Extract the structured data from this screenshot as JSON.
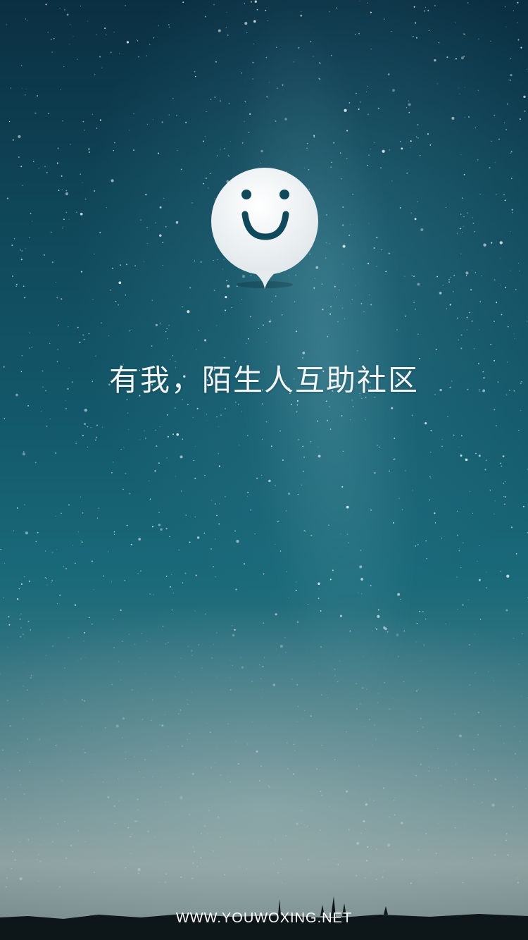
{
  "app": {
    "logo_icon": "smiley-chat-bubble-icon",
    "tagline": "有我，陌生人互助社区",
    "website": "WWW.YOUWOXING.NET"
  },
  "colors": {
    "sky_top": "#0b2f42",
    "sky_mid": "#13596b",
    "sky_horizon": "#8a9c9c",
    "logo_face": "#f3f5f6",
    "logo_feature": "#0f4a5c",
    "text": "#f2f6f7"
  }
}
